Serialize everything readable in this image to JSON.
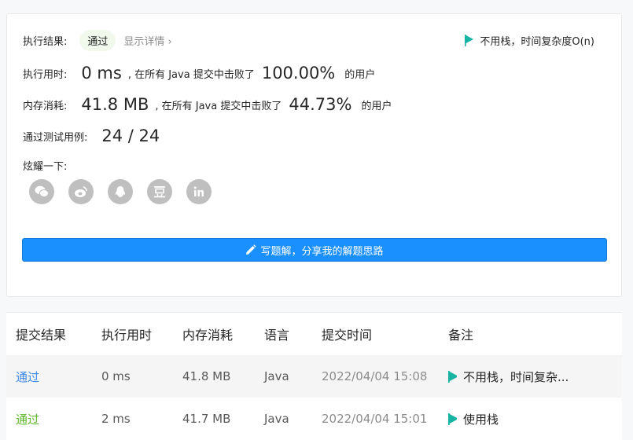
{
  "result": {
    "exec_label": "执行结果:",
    "status": "通过",
    "details_link": "显示详情 ›",
    "note": "不用栈，时间复杂度O(n)"
  },
  "runtime": {
    "label": "执行用时:",
    "value": "0 ms",
    "middle": ", 在所有 Java 提交中击败了",
    "percent": "100.00%",
    "suffix": "的用户"
  },
  "memory": {
    "label": "内存消耗:",
    "value": "41.8 MB",
    "middle": ", 在所有 Java 提交中击败了",
    "percent": "44.73%",
    "suffix": "的用户"
  },
  "tests": {
    "label": "通过测试用例:",
    "value": "24 / 24"
  },
  "share": {
    "label": "炫耀一下:",
    "icons": [
      "wechat-icon",
      "weibo-icon",
      "qq-icon",
      "douban-icon",
      "linkedin-icon"
    ]
  },
  "write_button": "写题解，分享我的解题思路",
  "table": {
    "headers": [
      "提交结果",
      "执行用时",
      "内存消耗",
      "语言",
      "提交时间",
      "备注"
    ],
    "rows": [
      {
        "status": "通过",
        "runtime": "0 ms",
        "memory": "41.8 MB",
        "lang": "Java",
        "time": "2022/04/04 15:08",
        "note": "不用栈，时间复杂..."
      },
      {
        "status": "通过",
        "runtime": "2 ms",
        "memory": "41.7 MB",
        "lang": "Java",
        "time": "2022/04/04 15:01",
        "note": "使用栈"
      }
    ]
  },
  "colors": {
    "accent": "#1a90ff",
    "flag": "#17b3a3",
    "pass_blue": "#3c8ae6",
    "pass_green": "#5cb82a"
  }
}
